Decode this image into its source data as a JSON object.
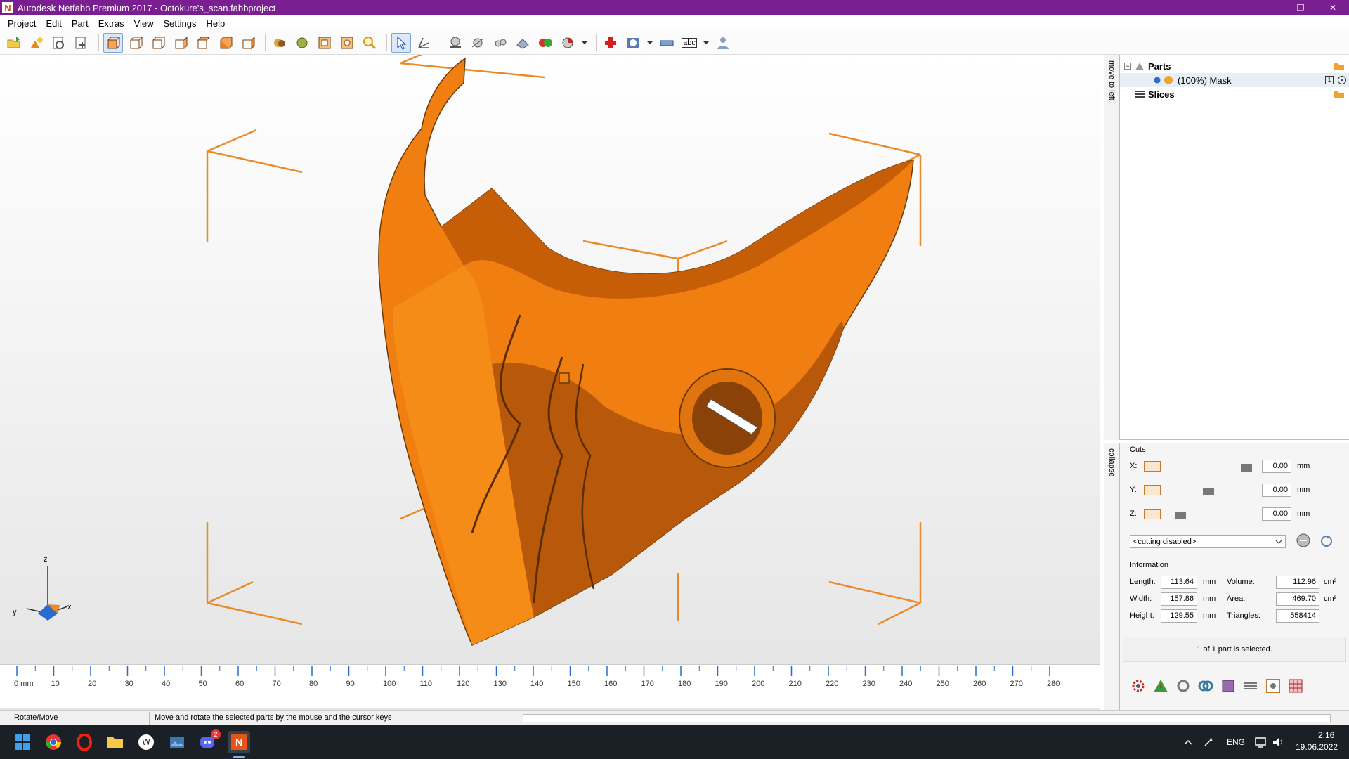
{
  "window": {
    "title": "Autodesk Netfabb Premium 2017 - Octokure's_scan.fabbproject",
    "logo_letter": "N",
    "minimize": "—",
    "restore": "❐",
    "close": "✕"
  },
  "menu": [
    "Project",
    "Edit",
    "Part",
    "Extras",
    "View",
    "Settings",
    "Help"
  ],
  "toolbar": {
    "text_tool_label": "abc"
  },
  "viewport": {
    "axis": {
      "z": "z",
      "y": "y",
      "x": "x"
    },
    "model_color": "#f07e10",
    "box_color": "#e88b28"
  },
  "ruler": {
    "labels": [
      "0 mm",
      "10",
      "20",
      "30",
      "40",
      "50",
      "60",
      "70",
      "80",
      "90",
      "100",
      "110",
      "120",
      "130",
      "140",
      "150",
      "160",
      "170",
      "180",
      "190",
      "200",
      "210",
      "220",
      "230",
      "240",
      "250",
      "260",
      "270",
      "280"
    ]
  },
  "side_tabs": {
    "move_to_left": "move to left",
    "collapse": "collapse"
  },
  "tree": {
    "parts_label": "Parts",
    "part_item": "(100%) Mask",
    "slices_label": "Slices"
  },
  "cuts": {
    "header": "Cuts",
    "x_label": "X:",
    "y_label": "Y:",
    "z_label": "Z:",
    "x_value": "0.00",
    "y_value": "0.00",
    "z_value": "0.00",
    "unit": "mm",
    "mode": "<cutting disabled>"
  },
  "information": {
    "header": "Information",
    "length_label": "Length:",
    "length_value": "113.64",
    "width_label": "Width:",
    "width_value": "157.86",
    "height_label": "Height:",
    "height_value": "129.55",
    "unit_mm": "mm",
    "volume_label": "Volume:",
    "volume_value": "112.96",
    "area_label": "Area:",
    "area_value": "469.70",
    "triangles_label": "Triangles:",
    "triangles_value": "558414",
    "unit_cm3": "cm³",
    "unit_cm2": "cm²",
    "selection_status": "1 of 1 part is selected."
  },
  "status": {
    "mode": "Rotate/Move",
    "hint": "Move and rotate the selected parts by the mouse and the cursor keys"
  },
  "taskbar": {
    "lang": "ENG",
    "time": "2:16",
    "date": "19.06.2022",
    "discord_badge": "2"
  }
}
